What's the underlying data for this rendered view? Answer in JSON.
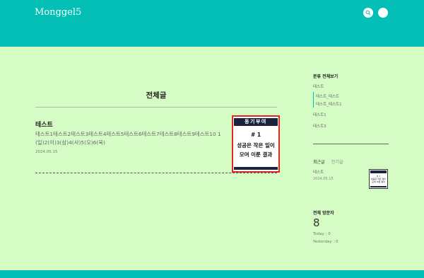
{
  "header": {
    "logo": "Monggel5",
    "colors": {
      "brand": "#03bfb5",
      "background": "#d6fcc6"
    },
    "icons": [
      "search-icon",
      "profile-icon"
    ]
  },
  "main": {
    "page_title": "전체글",
    "posts": [
      {
        "title": "테스트",
        "excerpt": "테스트1테스트2테스트3테스트4테스트5테스트6테스트7테스트8테스트9테스트10 1(일)2(이)3(삼)4(사)5(오)6(육)",
        "date": "2024.05.15",
        "thumbnail": {
          "banner": "동기부여",
          "number": "# 1",
          "line1": "성공은 작은 일이",
          "line2": "모여 이룬 결과"
        }
      }
    ]
  },
  "sidebar": {
    "categories": {
      "all_label": "분류 전체보기",
      "items": [
        "테스트",
        "테스트_테스트",
        "테스트_테스트1",
        "테스트1",
        "테스트3"
      ]
    },
    "tabs": {
      "recent": "최근글",
      "popular": "인기글"
    },
    "recent_post": {
      "title": "테스트",
      "date": "2024.05.15"
    },
    "visitors": {
      "heading": "전체 방문자",
      "total": "8",
      "today": "Today : 0",
      "yesterday": "Yesterday : 0"
    }
  }
}
